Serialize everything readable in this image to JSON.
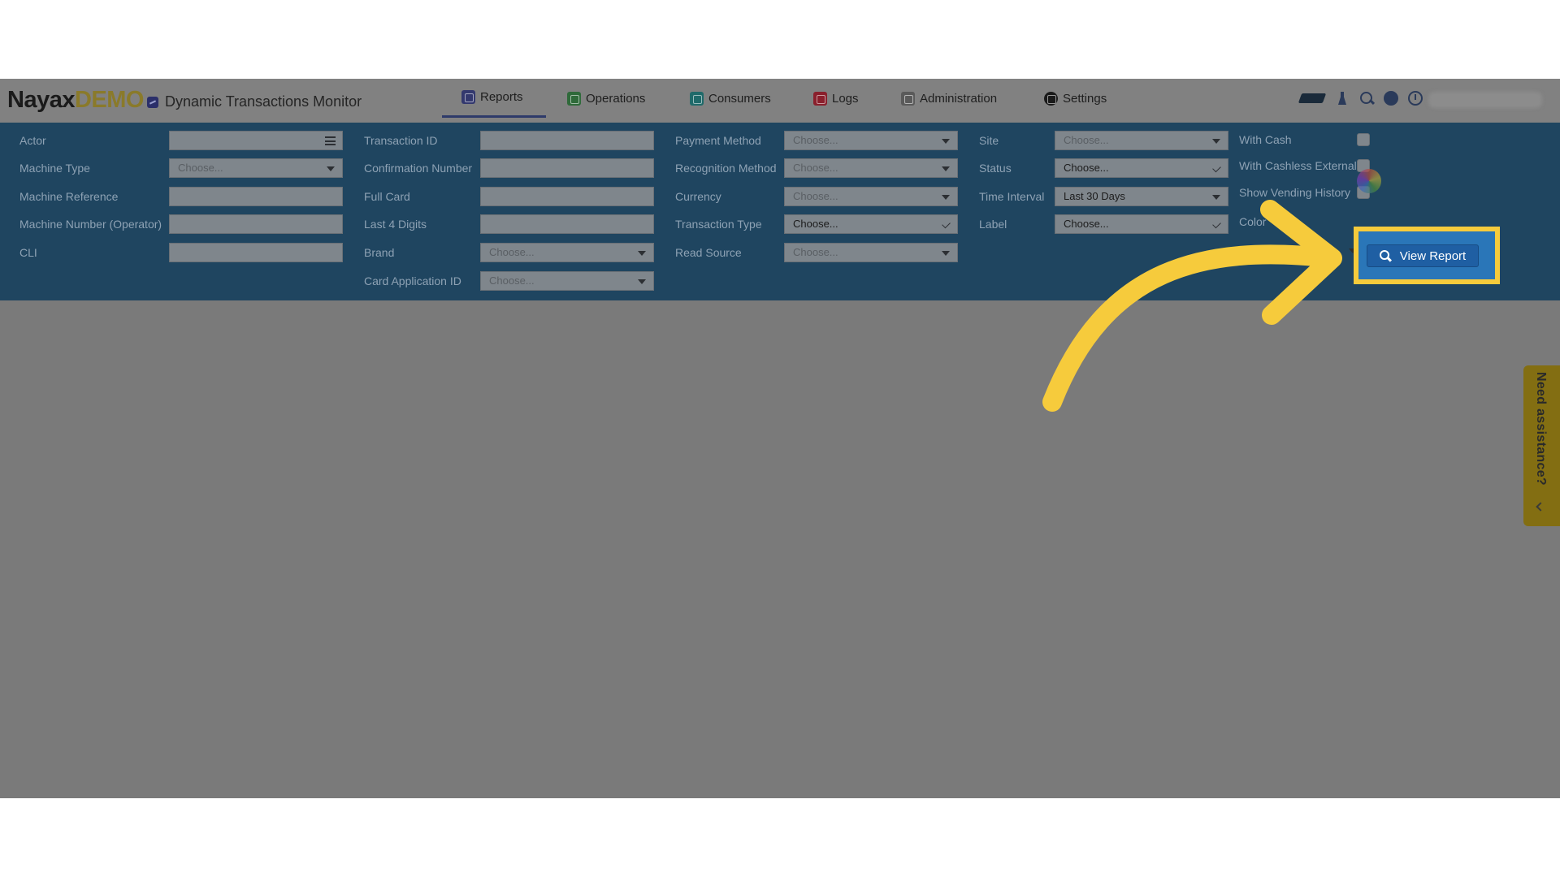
{
  "app": {
    "logo_brand": "Nayax",
    "logo_demo": "DEMO",
    "page_title": "Dynamic Transactions Monitor"
  },
  "nav": {
    "reports": "Reports",
    "operations": "Operations",
    "consumers": "Consumers",
    "logs": "Logs",
    "administration": "Administration",
    "settings": "Settings",
    "active": "Reports"
  },
  "filters": {
    "actor": {
      "label": "Actor",
      "value": ""
    },
    "machine_type": {
      "label": "Machine Type",
      "placeholder": "Choose..."
    },
    "machine_reference": {
      "label": "Machine Reference",
      "value": ""
    },
    "machine_number": {
      "label": "Machine Number (Operator)",
      "value": ""
    },
    "cli": {
      "label": "CLI",
      "value": ""
    },
    "transaction_id": {
      "label": "Transaction ID",
      "value": ""
    },
    "confirmation_number": {
      "label": "Confirmation Number",
      "value": ""
    },
    "full_card": {
      "label": "Full Card",
      "value": ""
    },
    "last4": {
      "label": "Last 4 Digits",
      "value": ""
    },
    "brand": {
      "label": "Brand",
      "placeholder": "Choose..."
    },
    "card_application_id": {
      "label": "Card Application ID",
      "placeholder": "Choose..."
    },
    "payment_method": {
      "label": "Payment Method",
      "placeholder": "Choose..."
    },
    "recognition_method": {
      "label": "Recognition Method",
      "placeholder": "Choose..."
    },
    "currency": {
      "label": "Currency",
      "placeholder": "Choose..."
    },
    "transaction_type": {
      "label": "Transaction Type",
      "value": "Choose..."
    },
    "read_source": {
      "label": "Read Source",
      "placeholder": "Choose..."
    },
    "site": {
      "label": "Site",
      "placeholder": "Choose..."
    },
    "status": {
      "label": "Status",
      "value": "Choose..."
    },
    "time_interval": {
      "label": "Time Interval",
      "value": "Last 30 Days"
    },
    "label": {
      "label": "Label",
      "value": "Choose..."
    },
    "with_cash": {
      "label": "With Cash",
      "checked": false
    },
    "with_cashless_external": {
      "label": "With Cashless External",
      "checked": false
    },
    "show_vending_history": {
      "label": "Show Vending History",
      "checked": false
    },
    "color_label": "Color"
  },
  "actions": {
    "view_report": "View Report"
  },
  "assistance": {
    "label": "Need assistance?"
  },
  "colors": {
    "panel": "#1f4560",
    "highlight": "#f6cb3c",
    "button": "#1f5fa3",
    "arrow": "#f6cb3c",
    "assist_tab": "#836e12"
  }
}
